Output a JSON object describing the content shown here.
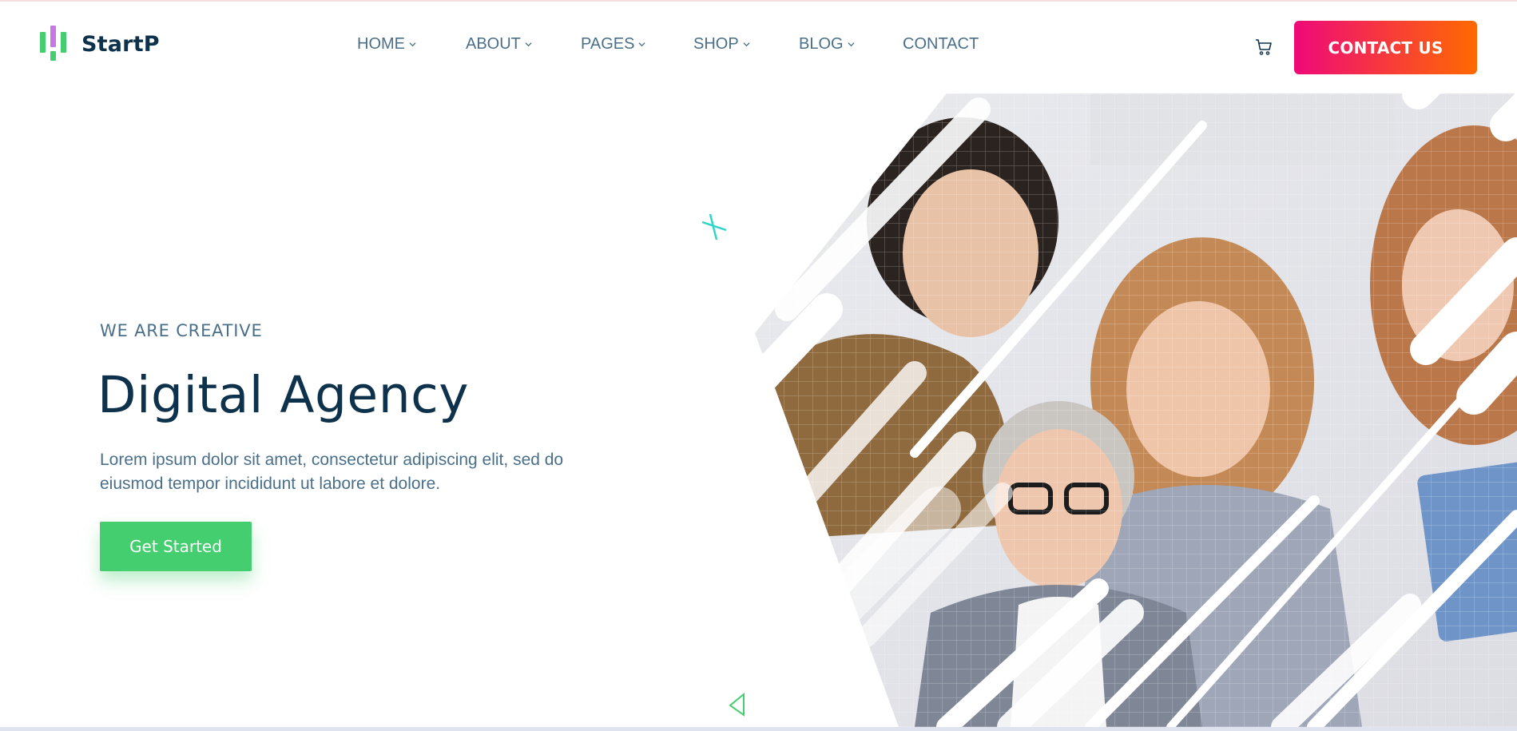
{
  "brand": {
    "name": "StartP",
    "accent_green": "#44ce6f",
    "accent_pink": "#ee0979",
    "accent_orange": "#ff6a00",
    "heading_color": "#0e314c",
    "text_color": "#4a6f8a"
  },
  "nav": {
    "items": [
      {
        "label": "HOME",
        "has_dropdown": true
      },
      {
        "label": "ABOUT",
        "has_dropdown": true
      },
      {
        "label": "PAGES",
        "has_dropdown": true
      },
      {
        "label": "SHOP",
        "has_dropdown": true
      },
      {
        "label": "BLOG",
        "has_dropdown": true
      },
      {
        "label": "CONTACT",
        "has_dropdown": false
      }
    ],
    "cart_icon": "cart-icon",
    "contact_button": "CONTACT US"
  },
  "hero": {
    "eyebrow": "WE ARE CREATIVE",
    "title": "Digital Agency",
    "description": "Lorem ipsum dolor sit amet, consectetur adipiscing elit, sed do eiusmod tempor incididunt ut labore et dolore.",
    "cta_label": "Get Started"
  }
}
